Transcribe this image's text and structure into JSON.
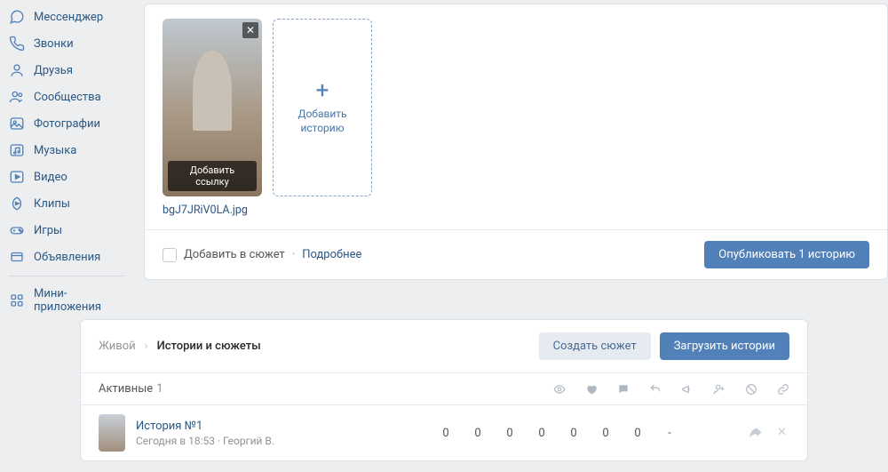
{
  "sidebar": {
    "items": [
      {
        "label": "Мессенджер"
      },
      {
        "label": "Звонки"
      },
      {
        "label": "Друзья"
      },
      {
        "label": "Сообщества"
      },
      {
        "label": "Фотографии"
      },
      {
        "label": "Музыка"
      },
      {
        "label": "Видео"
      },
      {
        "label": "Клипы"
      },
      {
        "label": "Игры"
      },
      {
        "label": "Объявления"
      },
      {
        "label": "Мини-приложения"
      }
    ]
  },
  "upload": {
    "ribbon": "Добавить ссылку",
    "add_story": "Добавить\nисторию",
    "filename": "bgJ7JRiV0LA.jpg",
    "add_to_plot_label": "Добавить в сюжет",
    "more_link": "Подробнее",
    "publish_btn": "Опубликовать 1 историю"
  },
  "lower": {
    "breadcrumb_root": "Живой",
    "breadcrumb_current": "Истории и сюжеты",
    "create_plot_btn": "Создать сюжет",
    "upload_stories_btn": "Загрузить истории",
    "active_label": "Активные",
    "active_count": "1",
    "story": {
      "title": "История №1",
      "subtitle": "Сегодня в 18:53 · Георгий В.",
      "stats": [
        "0",
        "0",
        "0",
        "0",
        "0",
        "0",
        "0",
        "-"
      ]
    }
  }
}
